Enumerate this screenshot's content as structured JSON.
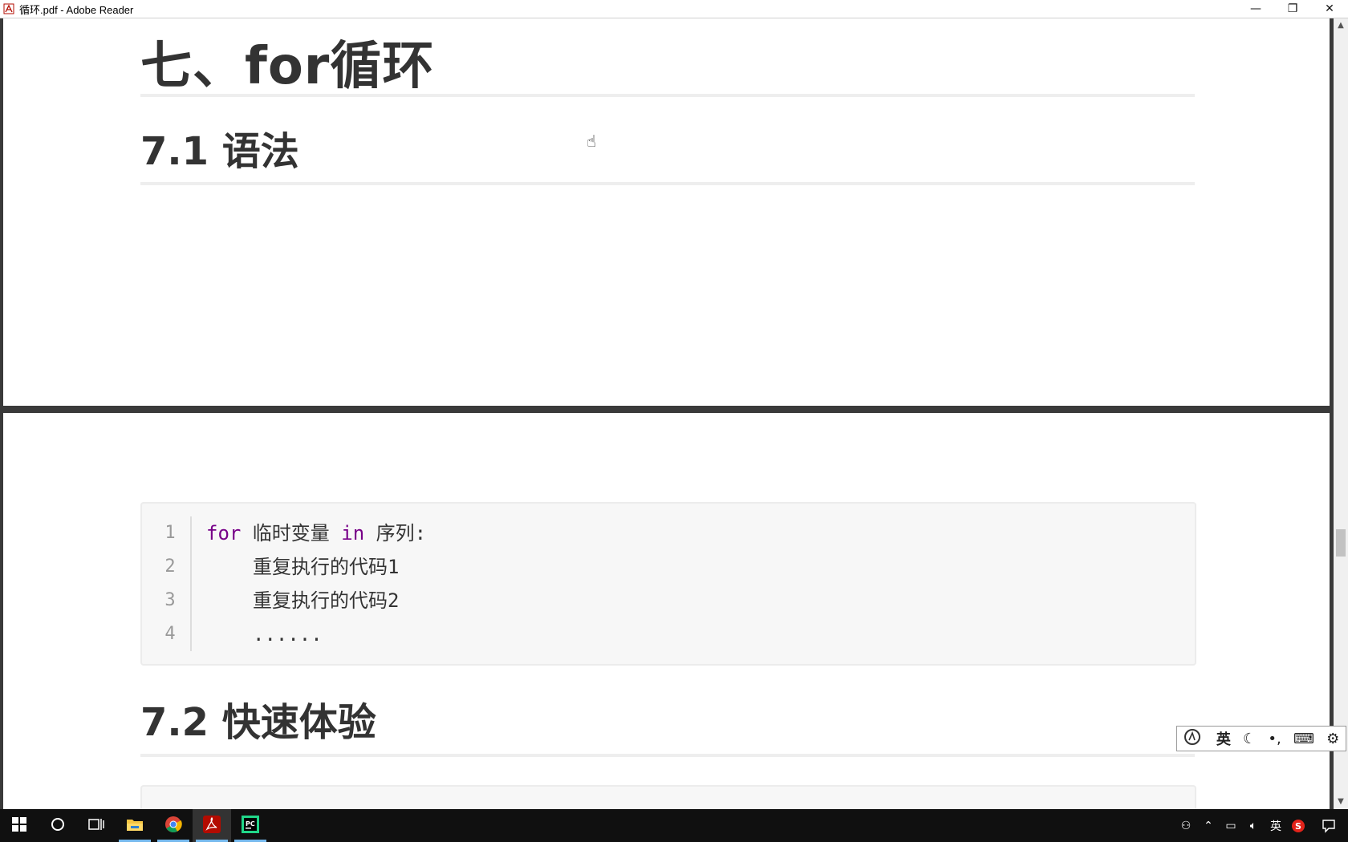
{
  "window": {
    "title": "循环.pdf - Adobe Reader",
    "controls": {
      "minimize": "—",
      "restore": "❐",
      "close": "✕"
    }
  },
  "document": {
    "heading1": "七、for循环",
    "heading2a": "7.1 语法",
    "heading2b": "7.2 快速体验",
    "code_block": {
      "line_numbers": [
        "1",
        "2",
        "3",
        "4"
      ],
      "line1": {
        "kw1": "for",
        "t1": " 临时变量 ",
        "kw2": "in",
        "t2": " 序列:"
      },
      "line2": "重复执行的代码1",
      "line3": "重复执行的代码2",
      "line4": "......"
    }
  },
  "ime_toolbar": {
    "mode": "英",
    "icons": [
      "sogou-logo-icon",
      "moon-icon",
      "punctuation-icon",
      "keyboard-icon",
      "gear-icon"
    ]
  },
  "taskbar": {
    "apps": [
      "start-icon",
      "search-icon",
      "task-view-icon",
      "file-explorer-icon",
      "chrome-icon",
      "adobe-reader-icon",
      "pycharm-icon"
    ],
    "tray_language": "英"
  },
  "colors": {
    "keyword": "#770088",
    "heading": "#333333",
    "code_bg": "#f7f7f7",
    "taskbar_bg": "#101010"
  }
}
